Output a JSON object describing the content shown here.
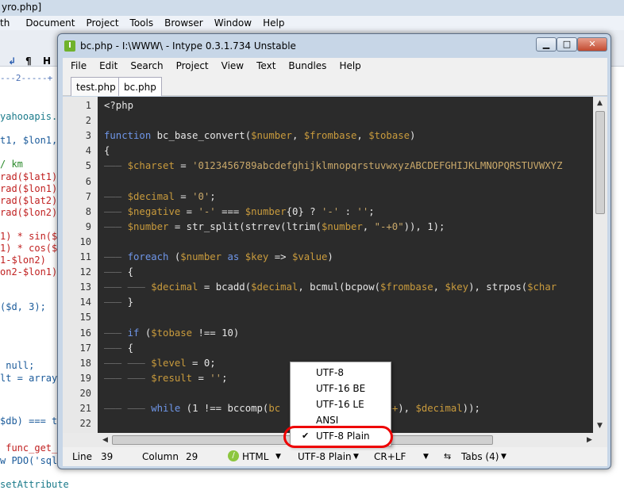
{
  "background_window": {
    "title": "yro.php]",
    "menu": [
      "th",
      "Document",
      "Project",
      "Tools",
      "Browser",
      "Window",
      "Help"
    ],
    "toolbar_glyphs": [
      "↲",
      "¶",
      "H"
    ],
    "ruler": "---2-----+",
    "code_lines": [
      {
        "text": "yahooapis.c",
        "color": "#1a7a8a"
      },
      {
        "text": "t1, $lon1,",
        "color": "#1a5a9a"
      },
      {
        "text": "/ km",
        "color": "#2b8a2b"
      },
      {
        "text": "rad($lat1)",
        "color": "#c02020"
      },
      {
        "text": "rad($lon1)",
        "color": "#c02020"
      },
      {
        "text": "rad($lat2)",
        "color": "#c02020"
      },
      {
        "text": "rad($lon2)",
        "color": "#c02020"
      },
      {
        "text": "1) * sin($",
        "color": "#c02020"
      },
      {
        "text": "1) * cos($",
        "color": "#c02020"
      },
      {
        "text": "1-$lon2)",
        "color": "#c02020"
      },
      {
        "text": "on2-$lon1)",
        "color": "#c02020"
      },
      {
        "text": "($d, 3);",
        "color": "#1a5a9a"
      },
      {
        "text": " null;",
        "color": "#1a5a9a"
      },
      {
        "text": "lt = array",
        "color": "#1a5a9a"
      },
      {
        "text": "$db) === t",
        "color": "#1a5a9a"
      },
      {
        "text": " func_get_",
        "color": "#c02020"
      },
      {
        "text": "w PDO('sql",
        "color": "#1a5a9a"
      },
      {
        "text": "setAttribute",
        "color": "#1a7a8a"
      }
    ]
  },
  "window": {
    "title": "bc.php - I:\\WWW\\ - Intype 0.3.1.734 Unstable",
    "controls": {
      "minimize": "▁",
      "maximize": "□",
      "close": "✕"
    },
    "menu": [
      "File",
      "Edit",
      "Search",
      "Project",
      "View",
      "Text",
      "Bundles",
      "Help"
    ],
    "tabs": [
      "test.php",
      "bc.php"
    ],
    "active_tab": "bc.php",
    "line_numbers": [
      "1",
      "2",
      "3",
      "4",
      "5",
      "6",
      "7",
      "8",
      "9",
      "10",
      "11",
      "12",
      "13",
      "14",
      "15",
      "16",
      "17",
      "18",
      "19",
      "20",
      "21",
      "22"
    ],
    "status": {
      "line_label": "Line",
      "line_value": "39",
      "column_label": "Column",
      "column_value": "29",
      "syntax": "HTML",
      "encoding": "UTF-8 Plain",
      "line_ending": "CR+LF",
      "indent": "Tabs (4)"
    },
    "encoding_menu": [
      "UTF-8",
      "UTF-16 BE",
      "UTF-16 LE",
      "ANSI",
      "UTF-8 Plain"
    ],
    "encoding_selected": "UTF-8 Plain"
  },
  "code": [
    [
      {
        "t": "<?php",
        "c": "pl"
      }
    ],
    [],
    [
      {
        "t": "function ",
        "c": "kw"
      },
      {
        "t": "bc_base_convert(",
        "c": "fn"
      },
      {
        "t": "$number",
        "c": "var"
      },
      {
        "t": ", ",
        "c": "op"
      },
      {
        "t": "$frombase",
        "c": "var"
      },
      {
        "t": ", ",
        "c": "op"
      },
      {
        "t": "$tobase",
        "c": "var"
      },
      {
        "t": ")",
        "c": "op"
      }
    ],
    [
      {
        "t": "{",
        "c": "pl"
      }
    ],
    [
      {
        "t": "——— ",
        "c": "guide"
      },
      {
        "t": "$charset",
        "c": "var"
      },
      {
        "t": " = ",
        "c": "op"
      },
      {
        "t": "'0123456789abcdefghijklmnopqrstuvwxyzABCDEFGHIJKLMNOPQRSTUVWXYZ",
        "c": "str"
      }
    ],
    [],
    [
      {
        "t": "——— ",
        "c": "guide"
      },
      {
        "t": "$decimal",
        "c": "var"
      },
      {
        "t": " = ",
        "c": "op"
      },
      {
        "t": "'0'",
        "c": "str"
      },
      {
        "t": ";",
        "c": "op"
      }
    ],
    [
      {
        "t": "——— ",
        "c": "guide"
      },
      {
        "t": "$negative",
        "c": "var"
      },
      {
        "t": " = ",
        "c": "op"
      },
      {
        "t": "'-'",
        "c": "str"
      },
      {
        "t": " === ",
        "c": "op"
      },
      {
        "t": "$number",
        "c": "var"
      },
      {
        "t": "{0} ? ",
        "c": "op"
      },
      {
        "t": "'-'",
        "c": "str"
      },
      {
        "t": " : ",
        "c": "op"
      },
      {
        "t": "''",
        "c": "str"
      },
      {
        "t": ";",
        "c": "op"
      }
    ],
    [
      {
        "t": "——— ",
        "c": "guide"
      },
      {
        "t": "$number",
        "c": "var"
      },
      {
        "t": " = ",
        "c": "op"
      },
      {
        "t": "str_split(strrev(ltrim(",
        "c": "fn"
      },
      {
        "t": "$number",
        "c": "var"
      },
      {
        "t": ", ",
        "c": "op"
      },
      {
        "t": "\"-+0\"",
        "c": "str"
      },
      {
        "t": ")), 1);",
        "c": "op"
      }
    ],
    [],
    [
      {
        "t": "——— ",
        "c": "guide"
      },
      {
        "t": "foreach",
        "c": "kw"
      },
      {
        "t": " (",
        "c": "op"
      },
      {
        "t": "$number",
        "c": "var"
      },
      {
        "t": " as ",
        "c": "kw"
      },
      {
        "t": "$key",
        "c": "var"
      },
      {
        "t": " => ",
        "c": "op"
      },
      {
        "t": "$value",
        "c": "var"
      },
      {
        "t": ")",
        "c": "op"
      }
    ],
    [
      {
        "t": "——— ",
        "c": "guide"
      },
      {
        "t": "{",
        "c": "pl"
      }
    ],
    [
      {
        "t": "——— ——— ",
        "c": "guide"
      },
      {
        "t": "$decimal",
        "c": "var"
      },
      {
        "t": " = ",
        "c": "op"
      },
      {
        "t": "bcadd(",
        "c": "fn"
      },
      {
        "t": "$decimal",
        "c": "var"
      },
      {
        "t": ", ",
        "c": "op"
      },
      {
        "t": "bcmul(bcpow(",
        "c": "fn"
      },
      {
        "t": "$frombase",
        "c": "var"
      },
      {
        "t": ", ",
        "c": "op"
      },
      {
        "t": "$key",
        "c": "var"
      },
      {
        "t": "), ",
        "c": "op"
      },
      {
        "t": "strpos(",
        "c": "fn"
      },
      {
        "t": "$char",
        "c": "var"
      }
    ],
    [
      {
        "t": "——— ",
        "c": "guide"
      },
      {
        "t": "}",
        "c": "pl"
      }
    ],
    [],
    [
      {
        "t": "——— ",
        "c": "guide"
      },
      {
        "t": "if",
        "c": "kw"
      },
      {
        "t": " (",
        "c": "op"
      },
      {
        "t": "$tobase",
        "c": "var"
      },
      {
        "t": " !== ",
        "c": "op"
      },
      {
        "t": "10",
        "c": "pl"
      },
      {
        "t": ")",
        "c": "op"
      }
    ],
    [
      {
        "t": "——— ",
        "c": "guide"
      },
      {
        "t": "{",
        "c": "pl"
      }
    ],
    [
      {
        "t": "——— ——— ",
        "c": "guide"
      },
      {
        "t": "$level",
        "c": "var"
      },
      {
        "t": " = 0;",
        "c": "op"
      }
    ],
    [
      {
        "t": "——— ——— ",
        "c": "guide"
      },
      {
        "t": "$result",
        "c": "var"
      },
      {
        "t": " = ",
        "c": "op"
      },
      {
        "t": "''",
        "c": "str"
      },
      {
        "t": ";",
        "c": "op"
      }
    ],
    [],
    [
      {
        "t": "——— ——— ",
        "c": "guide"
      },
      {
        "t": "while",
        "c": "kw"
      },
      {
        "t": " (1 !== ",
        "c": "op"
      },
      {
        "t": "bccomp(",
        "c": "fn"
      },
      {
        "t": "bc",
        "c": "var"
      },
      {
        "t": "              ",
        "c": "op"
      },
      {
        "t": "evel++",
        "c": "var"
      },
      {
        "t": "), ",
        "c": "op"
      },
      {
        "t": "$decimal",
        "c": "var"
      },
      {
        "t": "));",
        "c": "op"
      }
    ],
    []
  ]
}
